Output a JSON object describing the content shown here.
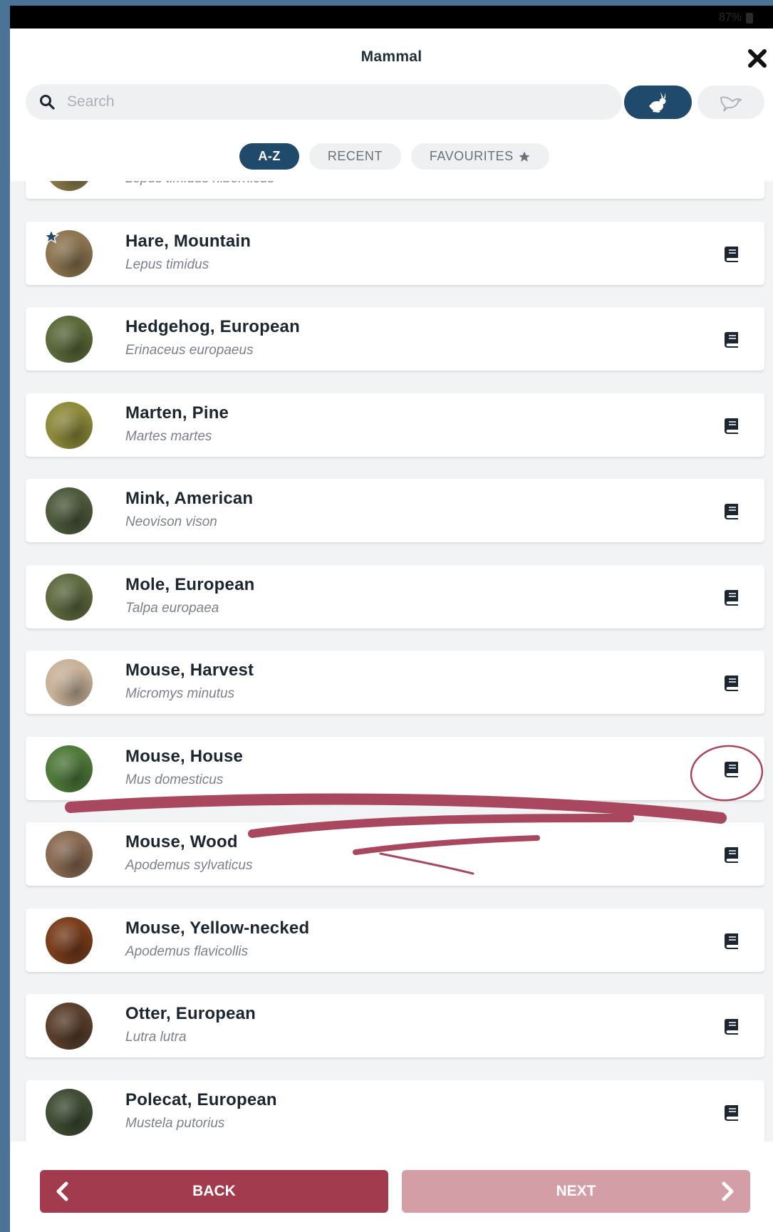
{
  "status_bar": {
    "battery": "87%"
  },
  "header": {
    "title": "Mammal",
    "search_placeholder": "Search",
    "category_buttons": [
      {
        "icon": "rabbit-icon",
        "active": true
      },
      {
        "icon": "bird-icon",
        "active": false
      }
    ],
    "tabs": [
      {
        "label": "A-Z",
        "active": true
      },
      {
        "label": "RECENT",
        "active": false
      },
      {
        "label": "FAVOURITES",
        "active": false,
        "icon": "star-icon"
      }
    ]
  },
  "species": [
    {
      "common": "",
      "latin": "Lepus timidus hibernicus",
      "favourite": false,
      "thumb_color": "#8a7a4c"
    },
    {
      "common": "Hare, Mountain",
      "latin": "Lepus timidus",
      "favourite": true,
      "thumb_color": "#8c7550"
    },
    {
      "common": "Hedgehog, European",
      "latin": "Erinaceus europaeus",
      "favourite": false,
      "thumb_color": "#5b6a3a"
    },
    {
      "common": "Marten, Pine",
      "latin": "Martes martes",
      "favourite": false,
      "thumb_color": "#8d8a3a"
    },
    {
      "common": "Mink, American",
      "latin": "Neovison vison",
      "favourite": false,
      "thumb_color": "#4d5a3c"
    },
    {
      "common": "Mole, European",
      "latin": "Talpa europaea",
      "favourite": false,
      "thumb_color": "#5e6a40"
    },
    {
      "common": "Mouse, Harvest",
      "latin": "Micromys minutus",
      "favourite": false,
      "thumb_color": "#c9b29a"
    },
    {
      "common": "Mouse, House",
      "latin": "Mus domesticus",
      "favourite": false,
      "thumb_color": "#4f7a3a"
    },
    {
      "common": "Mouse, Wood",
      "latin": "Apodemus sylvaticus",
      "favourite": false,
      "thumb_color": "#8a6a52"
    },
    {
      "common": "Mouse, Yellow-necked",
      "latin": "Apodemus flavicollis",
      "favourite": false,
      "thumb_color": "#7a3d1c"
    },
    {
      "common": "Otter, European",
      "latin": "Lutra lutra",
      "favourite": false,
      "thumb_color": "#5a3f2c"
    },
    {
      "common": "Polecat, European",
      "latin": "Mustela putorius",
      "favourite": false,
      "thumb_color": "#3f4d34"
    }
  ],
  "footer": {
    "back_label": "BACK",
    "next_label": "NEXT"
  },
  "colors": {
    "primary_navy": "#204a6b",
    "back_red": "#a33b4e",
    "next_pink": "#d39ea6",
    "annotation": "#a8475e"
  }
}
